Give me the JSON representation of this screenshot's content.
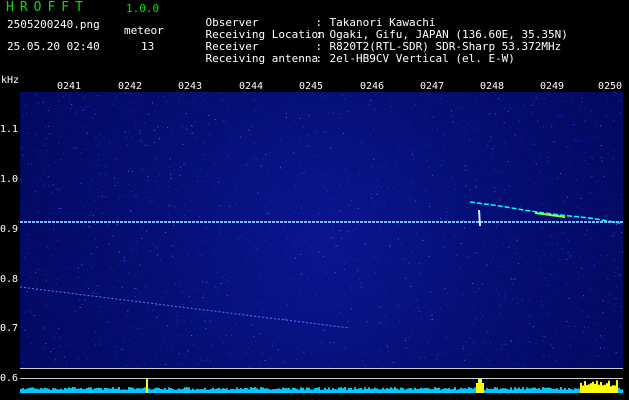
{
  "header": {
    "app_name": "HROFFT",
    "app_version": "1.0.0",
    "file_name": "2505200240.png",
    "meteor_label": "meteor",
    "timestamp": "25.05.20 02:40",
    "meteor_count": "13"
  },
  "info": {
    "observer_label": "Observer",
    "observer_value": "Takanori Kawachi",
    "location_label": "Receiving Location",
    "location_value": "Ogaki, Gifu, JAPAN (136.60E, 35.35N)",
    "receiver_label": "Receiver",
    "receiver_value": "R820T2(RTL-SDR) SDR-Sharp 53.372MHz",
    "antenna_label": "Receiving antenna",
    "antenna_value": "2el-HB9CV Vertical (el. E-W)",
    "separator": ":"
  },
  "axis": {
    "unit": "kHz",
    "freq_ticks": [
      "1.1",
      "1.0",
      "0.9",
      "0.8",
      "0.7",
      "0.6"
    ],
    "time_ticks": [
      "0241",
      "0242",
      "0243",
      "0244",
      "0245",
      "0246",
      "0247",
      "0248",
      "0249",
      "0250"
    ]
  },
  "colors": {
    "background": "#000000",
    "plot_bg": "#050d70",
    "title_green": "#00e000",
    "carrier": "#7fb8ff",
    "meteor_cyan": "#00ffff",
    "meteor_green": "#7cff4a",
    "histogram": "#00c8ff",
    "peaks": "#ffff00"
  }
}
